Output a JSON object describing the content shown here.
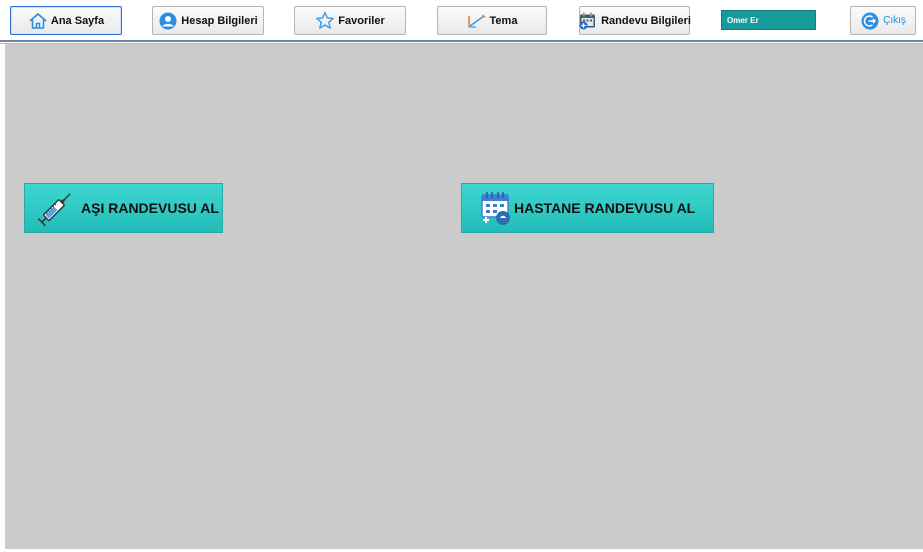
{
  "nav": {
    "home": {
      "label": "Ana Sayfa",
      "icon": "home-icon"
    },
    "account": {
      "label": "Hesap Bilgileri",
      "icon": "user-icon"
    },
    "favorites": {
      "label": "Favoriler",
      "icon": "star-icon"
    },
    "theme": {
      "label": "Tema",
      "icon": "brush-icon"
    },
    "appointments": {
      "label": "Randevu Bilgileri",
      "icon": "calendar-icon"
    },
    "exit": {
      "label": "Çıkış",
      "icon": "logout-icon"
    }
  },
  "user": {
    "name": "Omer Er"
  },
  "main": {
    "vaccine_button": {
      "label": "AŞI RANDEVUSU AL",
      "icon": "syringe-icon"
    },
    "hospital_button": {
      "label": "HASTANE RANDEVUSU AL",
      "icon": "hospital-calendar-icon"
    }
  },
  "colors": {
    "accent_teal": "#2ccbc6",
    "user_box": "#159b99",
    "content_bg": "#cbcbcb",
    "active_border": "#2f6fd0",
    "exit_text": "#1c8de0"
  }
}
